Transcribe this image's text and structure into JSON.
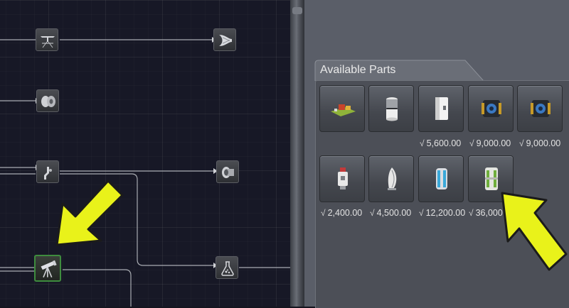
{
  "tree": {
    "nodes": [
      {
        "id": "n1",
        "icon": "landing-gear-icon"
      },
      {
        "id": "n2",
        "icon": "air-intake-icon"
      },
      {
        "id": "n3",
        "icon": "wheel-icon"
      },
      {
        "id": "n4",
        "icon": "robotic-arm-icon"
      },
      {
        "id": "n5",
        "icon": "jet-engine-icon"
      },
      {
        "id": "n6",
        "icon": "telescope-icon",
        "selected": true
      },
      {
        "id": "n7",
        "icon": "science-flask-icon"
      }
    ]
  },
  "panel": {
    "title": "Available Parts",
    "currency_symbol": "√",
    "parts": [
      {
        "icon": "surface-base-icon",
        "cost": ""
      },
      {
        "icon": "canister-icon",
        "cost": ""
      },
      {
        "icon": "white-module-icon",
        "cost": "5,600.00"
      },
      {
        "icon": "probe-core-icon",
        "cost": "9,000.00"
      },
      {
        "icon": "probe-core-icon-2",
        "cost": "9,000.00"
      },
      {
        "icon": "sensor-module-icon",
        "cost": "2,400.00"
      },
      {
        "icon": "antenna-dish-icon",
        "cost": "4,500.00"
      },
      {
        "icon": "cryo-tank-icon",
        "cost": "12,200.00"
      },
      {
        "icon": "habitat-module-icon",
        "cost": "36,000"
      }
    ]
  },
  "colors": {
    "highlight_arrow": "#e9f21a",
    "selected_node": "#3e8c3e",
    "panel_bg": "#5a5e68"
  }
}
